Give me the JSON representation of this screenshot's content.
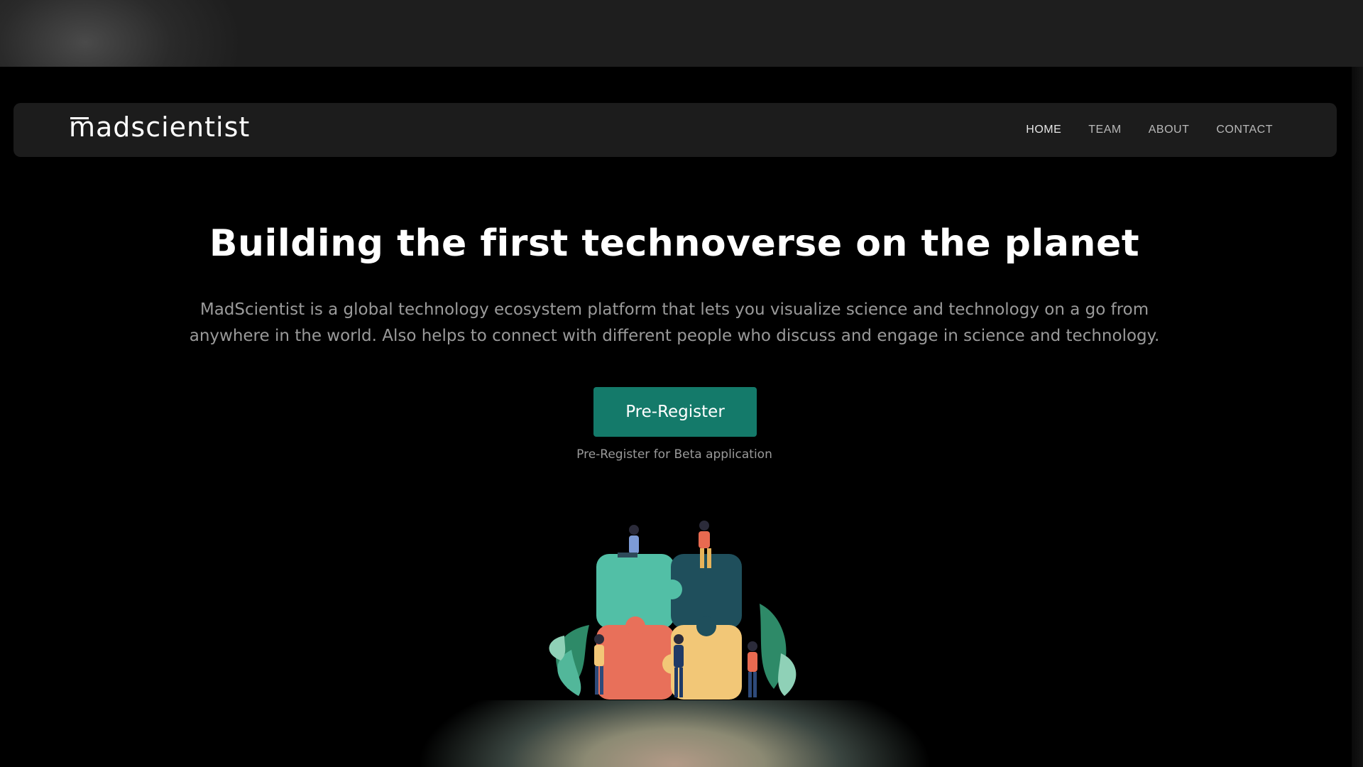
{
  "nav": {
    "logo": "madscientist",
    "links": [
      "HOME",
      "TEAM",
      "ABOUT",
      "CONTACT"
    ],
    "active": "HOME"
  },
  "hero": {
    "headline": "Building the first technoverse on the planet",
    "description": "MadScientist is a global technology ecosystem platform that lets you visualize science and technology on a go from anywhere in the world. Also helps to connect with different people who discuss and engage in science and technology.",
    "cta_label": "Pre-Register",
    "cta_note": "Pre-Register for Beta application"
  },
  "illustration": {
    "icon": "puzzle-teamwork-illustration"
  },
  "colors": {
    "background": "#000000",
    "navbar": "#1c1c1c",
    "accent": "#147a6a",
    "muted_text": "#9a9a9a"
  }
}
